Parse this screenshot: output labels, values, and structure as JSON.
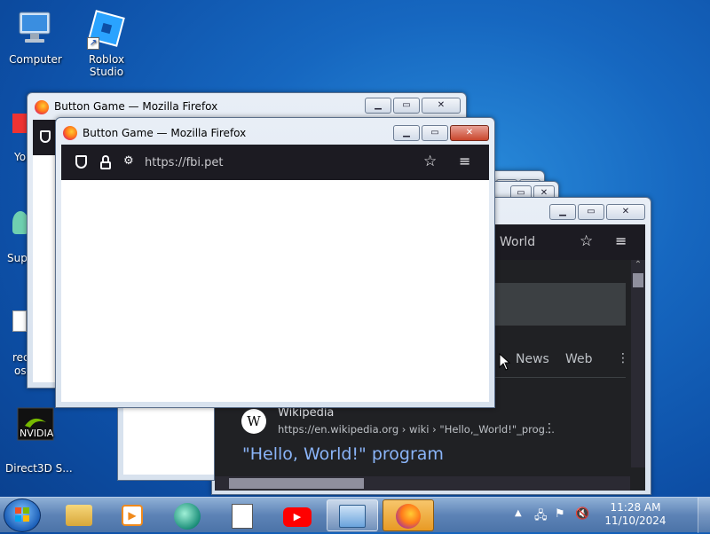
{
  "desktop": {
    "icons": [
      {
        "label": "Computer",
        "icon": "computer-icon"
      },
      {
        "label": "Roblox Studio",
        "icon": "roblox-studio-icon"
      }
    ],
    "partial_labels": [
      "Yo",
      "Sup",
      "rec",
      "os",
      "NVIDIA",
      "Direct3D S..."
    ]
  },
  "windows": {
    "back": {
      "title": "Button Game — Mozilla Firefox"
    },
    "front": {
      "title": "Button Game — Mozilla Firefox",
      "url": "https://fbi.pet"
    },
    "search": {
      "query_fragment": "World",
      "tabs": [
        "News",
        "Web"
      ],
      "result": {
        "site_name": "Wikipedia",
        "url": "https://en.wikipedia.org › wiki › \"Hello,_World!\"_prog...",
        "title": "\"Hello, World!\" program"
      }
    }
  },
  "taskbar": {
    "apps": [
      "file-explorer-icon",
      "media-player-icon",
      "globe-app-icon",
      "notepad-icon",
      "youtube-icon",
      "control-panel-icon",
      "firefox-icon"
    ],
    "clock": {
      "time": "11:28 AM",
      "date": "11/10/2024"
    }
  },
  "colors": {
    "firefox_dark": "#1c1b22",
    "link_blue": "#8ab4f8",
    "taskbar_active": "#e89a24"
  }
}
